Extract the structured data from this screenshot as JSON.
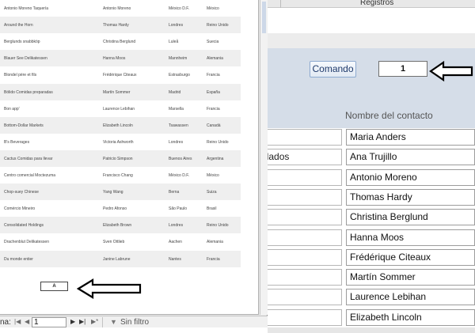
{
  "background_form": {
    "header_title": "Registros",
    "command_button": "Comando",
    "number_value": "1",
    "contact_column_header": "Nombre del contacto",
    "left_cell_partial": "elados",
    "contacts": [
      "Maria Anders",
      "Ana Trujillo",
      "Antonio Moreno",
      "Thomas Hardy",
      "Christina Berglund",
      "Hanna Moos",
      "Frédérique Citeaux",
      "Martín Sommer",
      "Laurence Lebihan",
      "Elizabeth Lincoln"
    ]
  },
  "report_preview": {
    "rows": [
      {
        "company": "Antonio Moreno Taquería",
        "contact": "Antonio Moreno",
        "city": "México D.F.",
        "country": "México"
      },
      {
        "company": "Around the Horn",
        "contact": "Thomas Hardy",
        "city": "Londres",
        "country": "Reino Unido"
      },
      {
        "company": "Berglunds snabbköp",
        "contact": "Christina Berglund",
        "city": "Luleå",
        "country": "Suecia"
      },
      {
        "company": "Blauer See Delikatessen",
        "contact": "Hanna Moos",
        "city": "Mannheim",
        "country": "Alemania"
      },
      {
        "company": "Blondel père et fils",
        "contact": "Frédérique Citeaux",
        "city": "Estrasburgo",
        "country": "Francia"
      },
      {
        "company": "Bólido Comidas preparadas",
        "contact": "Martín Sommer",
        "city": "Madrid",
        "country": "España"
      },
      {
        "company": "Bon app'",
        "contact": "Laurence Lebihan",
        "city": "Marsella",
        "country": "Francia"
      },
      {
        "company": "Bottom-Dollar Markets",
        "contact": "Elizabeth Lincoln",
        "city": "Tsawassen",
        "country": "Canadá"
      },
      {
        "company": "B's Beverages",
        "contact": "Victoria Ashworth",
        "city": "Londres",
        "country": "Reino Unido"
      },
      {
        "company": "Cactus Comidas para llevar",
        "contact": "Patricio Simpson",
        "city": "Buenos Aires",
        "country": "Argentina"
      },
      {
        "company": "Centro comercial Moctezuma",
        "contact": "Francisco Chang",
        "city": "México D.F.",
        "country": "México"
      },
      {
        "company": "Chop-suey Chinese",
        "contact": "Yang Wang",
        "city": "Berna",
        "country": "Suiza"
      },
      {
        "company": "Comércio Mineiro",
        "contact": "Pedro Afonso",
        "city": "São Paulo",
        "country": "Brasil"
      },
      {
        "company": "Consolidated Holdings",
        "contact": "Elizabeth Brown",
        "city": "Londres",
        "country": "Reino Unido"
      },
      {
        "company": "Drachenblut Delikatessen",
        "contact": "Sven Ottlieb",
        "city": "Aachen",
        "country": "Alemania"
      },
      {
        "company": "Du monde entier",
        "contact": "Janine Labrune",
        "city": "Nantes",
        "country": "Francia"
      }
    ],
    "page_label": "A"
  },
  "navbar": {
    "label": "na:",
    "current_record": "1",
    "filter_label": "Sin filtro"
  },
  "icons": {
    "first": "first-record-icon",
    "prev": "previous-record-icon",
    "next": "next-record-icon",
    "last": "last-record-icon",
    "filter": "filter-icon",
    "arrow": "arrow-icon"
  },
  "colors": {
    "panel": "#d5dde8",
    "button_border": "#8eaad0",
    "row_shade": "#efefef"
  }
}
